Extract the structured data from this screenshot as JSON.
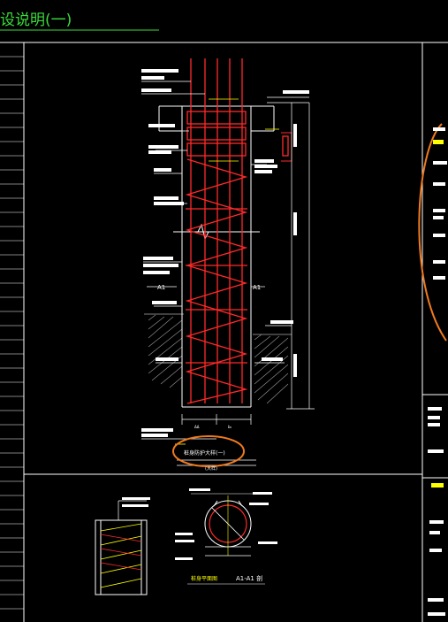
{
  "sheet_title": "设说明(一)",
  "labels": {
    "section_label": "A1",
    "section_label_right": "A1",
    "section_view": "A1-A1 剖",
    "detail_caption": "桩身防护大样(一)",
    "scale_note": "(大样)",
    "plan_caption": "桩身平面图",
    "left_dim": "ΔΔ",
    "right_dim": "b₀"
  },
  "colors": {
    "background": "#000000",
    "frame": "#ffffff",
    "rebar": "#ff2a2a",
    "annotation": "#ffffff",
    "highlight": "#ffff00",
    "markup": "#f07a1e",
    "title": "#3cdc3c",
    "hatch": "#9a9a9a"
  }
}
